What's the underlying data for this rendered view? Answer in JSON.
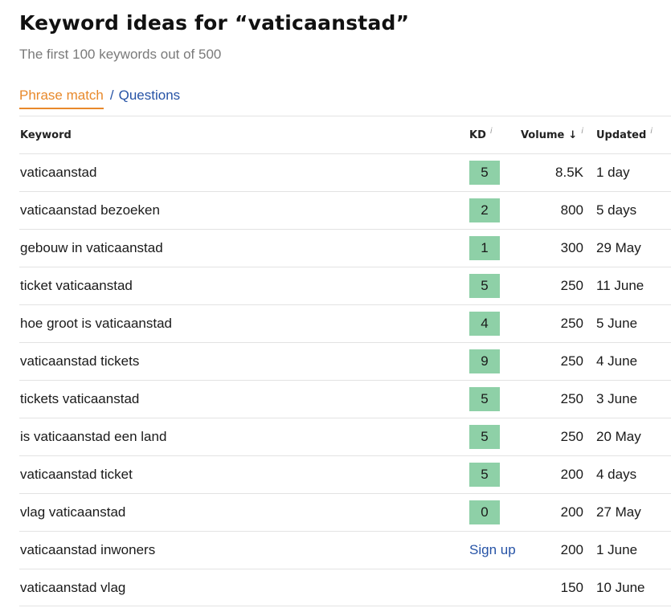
{
  "title": "Keyword ideas for “vaticaanstad”",
  "subtitle": "The first 100 keywords out of 500",
  "tabs": {
    "phrase": "Phrase match",
    "separator": "/",
    "questions": "Questions"
  },
  "headers": {
    "keyword": "Keyword",
    "kd": "KD",
    "volume": "Volume",
    "updated": "Updated",
    "info": "i",
    "sort_arrow": "↓"
  },
  "kd_color": "#8ed0a7",
  "rows": [
    {
      "keyword": "vaticaanstad",
      "kd": "5",
      "volume": "8.5K",
      "updated": "1 day"
    },
    {
      "keyword": "vaticaanstad bezoeken",
      "kd": "2",
      "volume": "800",
      "updated": "5 days"
    },
    {
      "keyword": "gebouw in vaticaanstad",
      "kd": "1",
      "volume": "300",
      "updated": "29 May"
    },
    {
      "keyword": "ticket vaticaanstad",
      "kd": "5",
      "volume": "250",
      "updated": "11 June"
    },
    {
      "keyword": "hoe groot is vaticaanstad",
      "kd": "4",
      "volume": "250",
      "updated": "5 June"
    },
    {
      "keyword": "vaticaanstad tickets",
      "kd": "9",
      "volume": "250",
      "updated": "4 June"
    },
    {
      "keyword": "tickets vaticaanstad",
      "kd": "5",
      "volume": "250",
      "updated": "3 June"
    },
    {
      "keyword": "is vaticaanstad een land",
      "kd": "5",
      "volume": "250",
      "updated": "20 May"
    },
    {
      "keyword": "vaticaanstad ticket",
      "kd": "5",
      "volume": "200",
      "updated": "4 days"
    },
    {
      "keyword": "vlag vaticaanstad",
      "kd": "0",
      "volume": "200",
      "updated": "27 May"
    },
    {
      "keyword": "vaticaanstad inwoners",
      "kd_link": "Sign up",
      "volume": "200",
      "updated": "1 June"
    },
    {
      "keyword": "vaticaanstad vlag",
      "volume": "150",
      "updated": "10 June"
    }
  ]
}
